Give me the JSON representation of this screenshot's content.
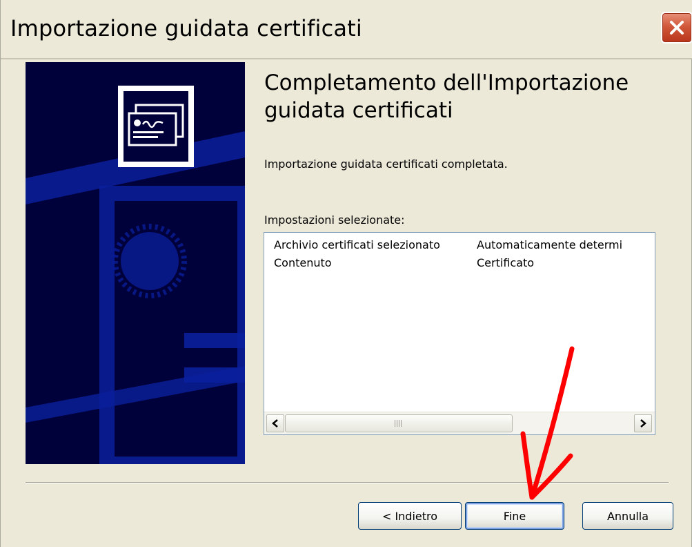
{
  "window": {
    "title": "Importazione guidata certificati"
  },
  "content": {
    "heading": "Completamento dell'Importazione guidata certificati",
    "message": "Importazione guidata certificati completata.",
    "settings_label": "Impostazioni selezionate:",
    "settings_rows": [
      {
        "name": "Archivio certificati selezionato",
        "value": "Automaticamente determi"
      },
      {
        "name": "Contenuto",
        "value": "Certificato"
      }
    ]
  },
  "buttons": {
    "back": "< Indietro",
    "finish": "Fine",
    "cancel": "Annulla"
  },
  "icons": {
    "close": "close-icon",
    "sidebar_emblem": "certificate-icon",
    "scroll_left": "scroll-left-arrow-icon",
    "scroll_right": "scroll-right-arrow-icon",
    "annotation": "red-arrow-annotation"
  },
  "colors": {
    "window_bg": "#ece9d8",
    "sidebar_bg": "#00003a",
    "sidebar_accent": "#0a1f9c",
    "close_button": "#d1583a",
    "annotation_red": "#ff0000"
  }
}
